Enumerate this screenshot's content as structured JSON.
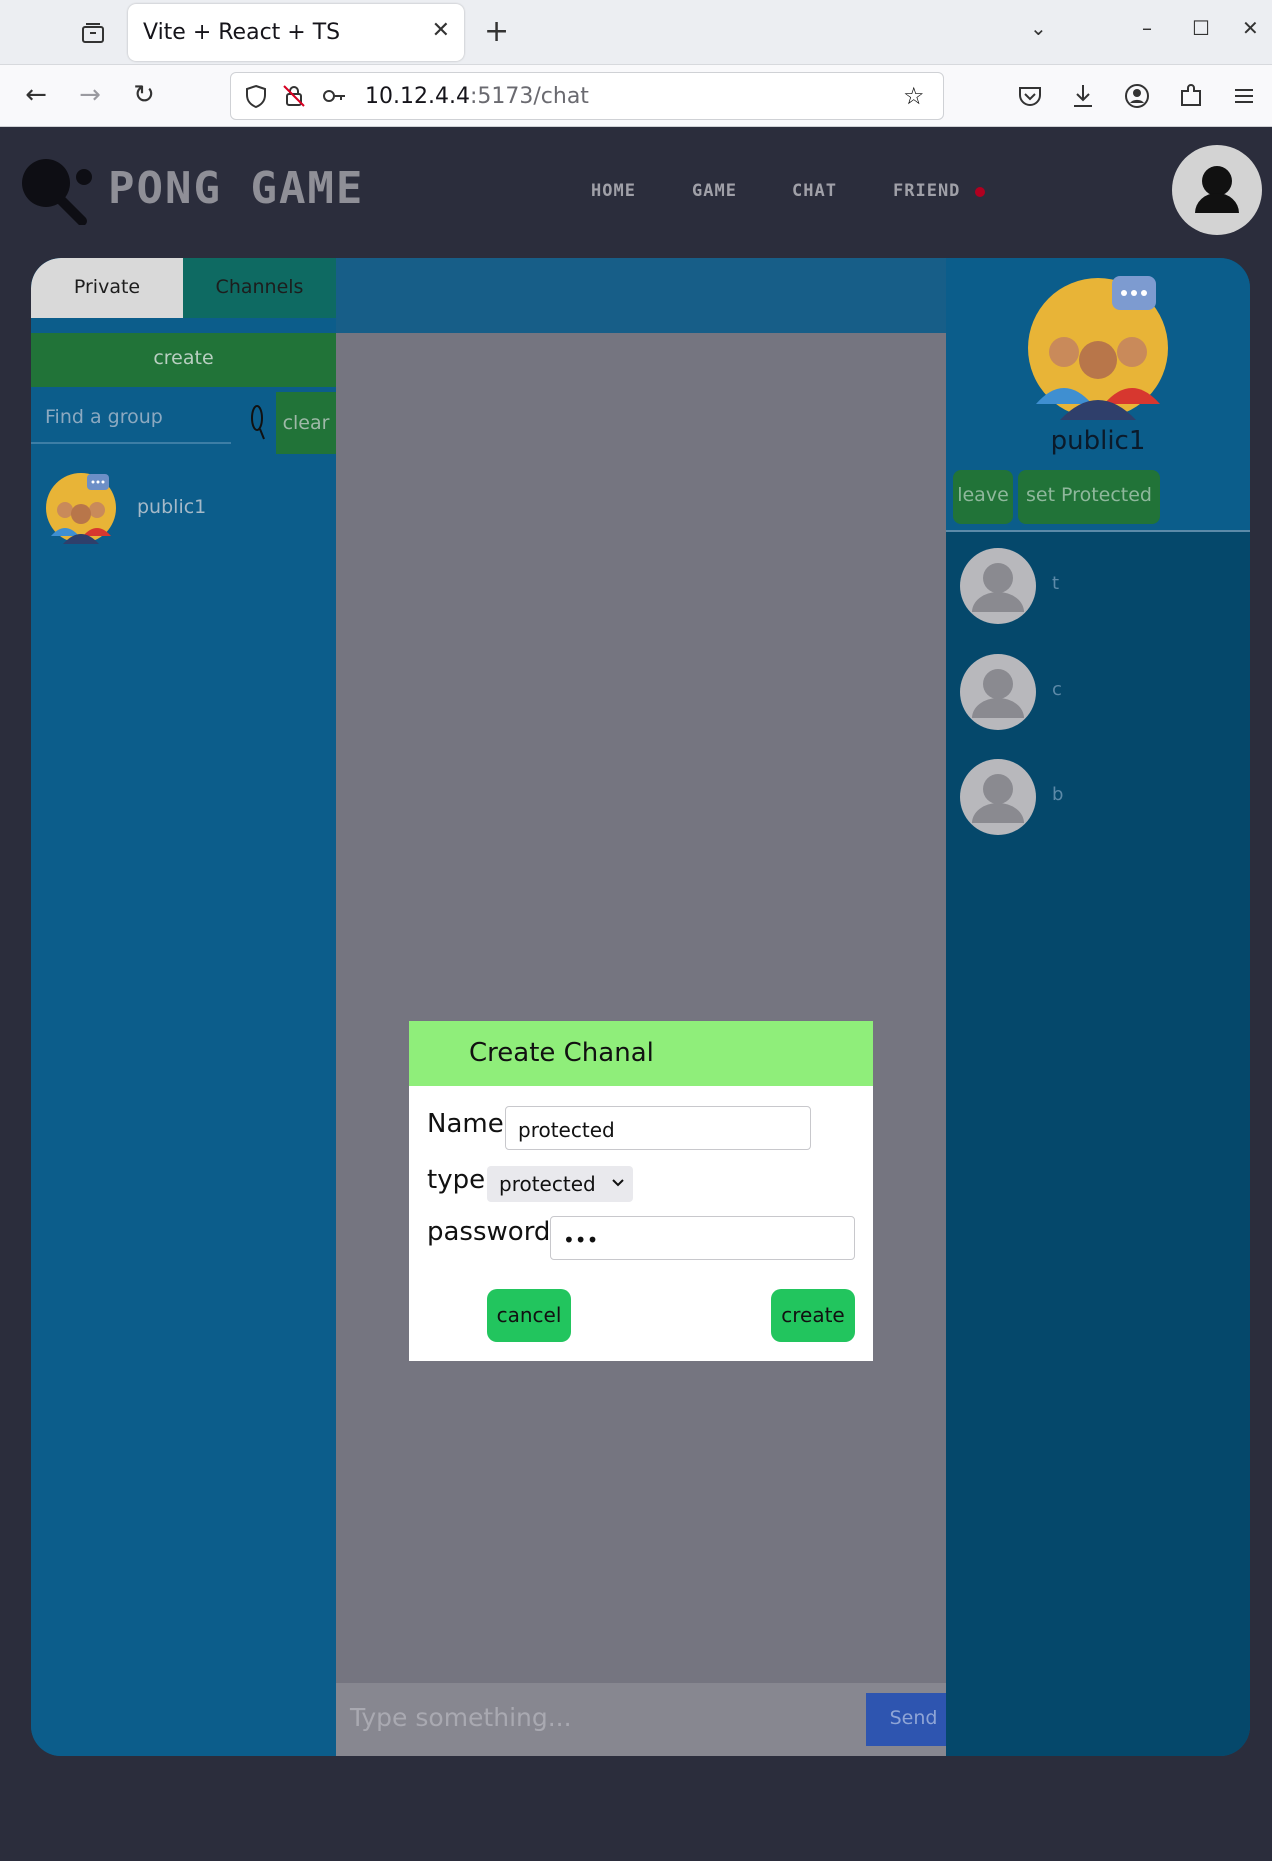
{
  "browser": {
    "tab_title": "Vite + React + TS",
    "url_host": "10.12.4.4",
    "url_rest": ":5173/chat"
  },
  "app": {
    "logo_text": "PONG GAME",
    "menu": [
      "HOME",
      "GAME",
      "CHAT",
      "FRIEND"
    ],
    "colors": {
      "background": "#2b2d3c",
      "panel_blue": "#0a5d8a",
      "green": "#217338",
      "modal_header": "#8fee7a",
      "modal_button": "#22c55e",
      "send_button": "#2e55b0",
      "notification_dot": "#b00020"
    }
  },
  "left_panel": {
    "tabs": [
      "Private",
      "Channels"
    ],
    "create_label": "create",
    "search_placeholder": "Find a group",
    "clear_label": "clear",
    "groups": [
      {
        "name": "public1"
      }
    ]
  },
  "chat": {
    "input_placeholder": "Type something...",
    "send_label": "Send"
  },
  "right_panel": {
    "group_name": "public1",
    "leave_label": "leave",
    "set_protected_label": "set Protected",
    "members": [
      {
        "name": "t"
      },
      {
        "name": "c"
      },
      {
        "name": "b"
      }
    ]
  },
  "modal": {
    "title": "Create Chanal",
    "name_label": "Name",
    "name_value": "protected",
    "type_label": "type",
    "type_value": "protected",
    "password_label": "password",
    "password_value": "•••",
    "cancel_label": "cancel",
    "create_label": "create"
  }
}
